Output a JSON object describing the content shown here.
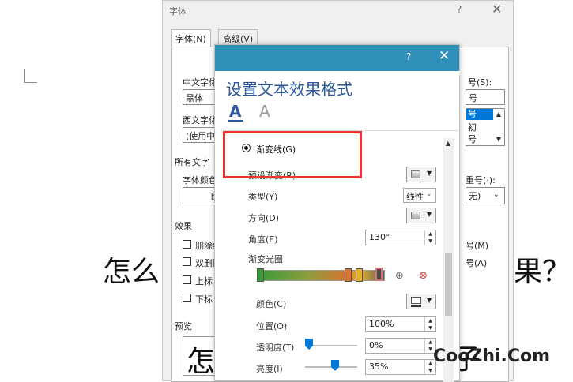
{
  "document": {
    "text_left": "怎么",
    "text_right": "果？",
    "preview_left": "怎",
    "preview_right": "子"
  },
  "font_dialog": {
    "title": "字体",
    "help": "?",
    "close": "✕",
    "tabs": [
      {
        "label": "字体(N)"
      },
      {
        "label": "高级(V)"
      }
    ],
    "chinese_font_label": "中文字体",
    "chinese_font_value": "黑体",
    "western_font_label": "西文字体",
    "western_font_value": "(使用中",
    "all_text_label": "所有文字",
    "font_color_label": "字体颜色",
    "font_color_value": "自",
    "size_label": "号(S):",
    "size_value": "号",
    "size_list": [
      "号",
      "初",
      "号"
    ],
    "emphasis_label": "重号(·):",
    "emphasis_value": "无)",
    "effects_label": "效果",
    "effects": [
      {
        "label": "删除线",
        "right": ""
      },
      {
        "label": "双删除",
        "right": "号(M)"
      },
      {
        "label": "上标",
        "right": "号(A)"
      },
      {
        "label": "下标",
        "right": ""
      }
    ],
    "preview_label": "预览"
  },
  "effects_pane": {
    "help": "?",
    "close": "✕",
    "heading": "设置文本效果格式",
    "tab_fill_icon": "A",
    "tab_effects_icon": "A",
    "gradient_line_label": "渐变线(G)",
    "preset_label": "预设渐变(R)",
    "type_label": "类型(Y)",
    "type_value": "线性",
    "direction_label": "方向(D)",
    "angle_label": "角度(E)",
    "angle_value": "130°",
    "stops_label": "渐变光圈",
    "color_label": "颜色(C)",
    "position_label": "位置(O)",
    "position_value": "100%",
    "transparency_label": "透明度(T)",
    "transparency_value": "0%",
    "transparency_level": 0,
    "brightness_label": "亮度(I)",
    "brightness_value": "35%",
    "brightness_level": 0.35
  },
  "watermark": "CooZhi.Com",
  "colors": {
    "titlebar": "#2e8fb9",
    "heading": "#2b579a",
    "highlight": "#e33333",
    "slider": "#0078d7"
  }
}
